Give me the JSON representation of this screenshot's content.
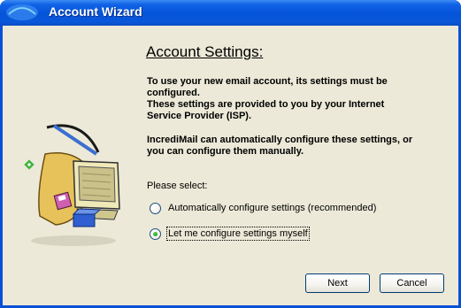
{
  "window": {
    "title": "Account Wizard"
  },
  "content": {
    "heading": "Account Settings:",
    "paragraph1_lines": [
      "To use your new email account, its settings must be",
      "configured.",
      "These settings are provided to you by your Internet",
      "Service Provider (ISP)."
    ],
    "paragraph2_lines": [
      "IncrediMail can automatically configure these settings, or",
      "you can configure them manually."
    ],
    "prompt": "Please select:",
    "options": [
      {
        "label": "Automatically configure settings (recommended)",
        "selected": false
      },
      {
        "label": "Let me configure settings myself",
        "selected": true
      }
    ]
  },
  "buttons": {
    "next": "Next",
    "cancel": "Cancel"
  },
  "colors": {
    "titlebar": "#0553d8",
    "client_bg": "#ece9d8",
    "radio_dot": "#21a121"
  },
  "icons": {
    "title_icon": "incredimail-title-icon",
    "illustration": "computer-setup-illustration"
  }
}
